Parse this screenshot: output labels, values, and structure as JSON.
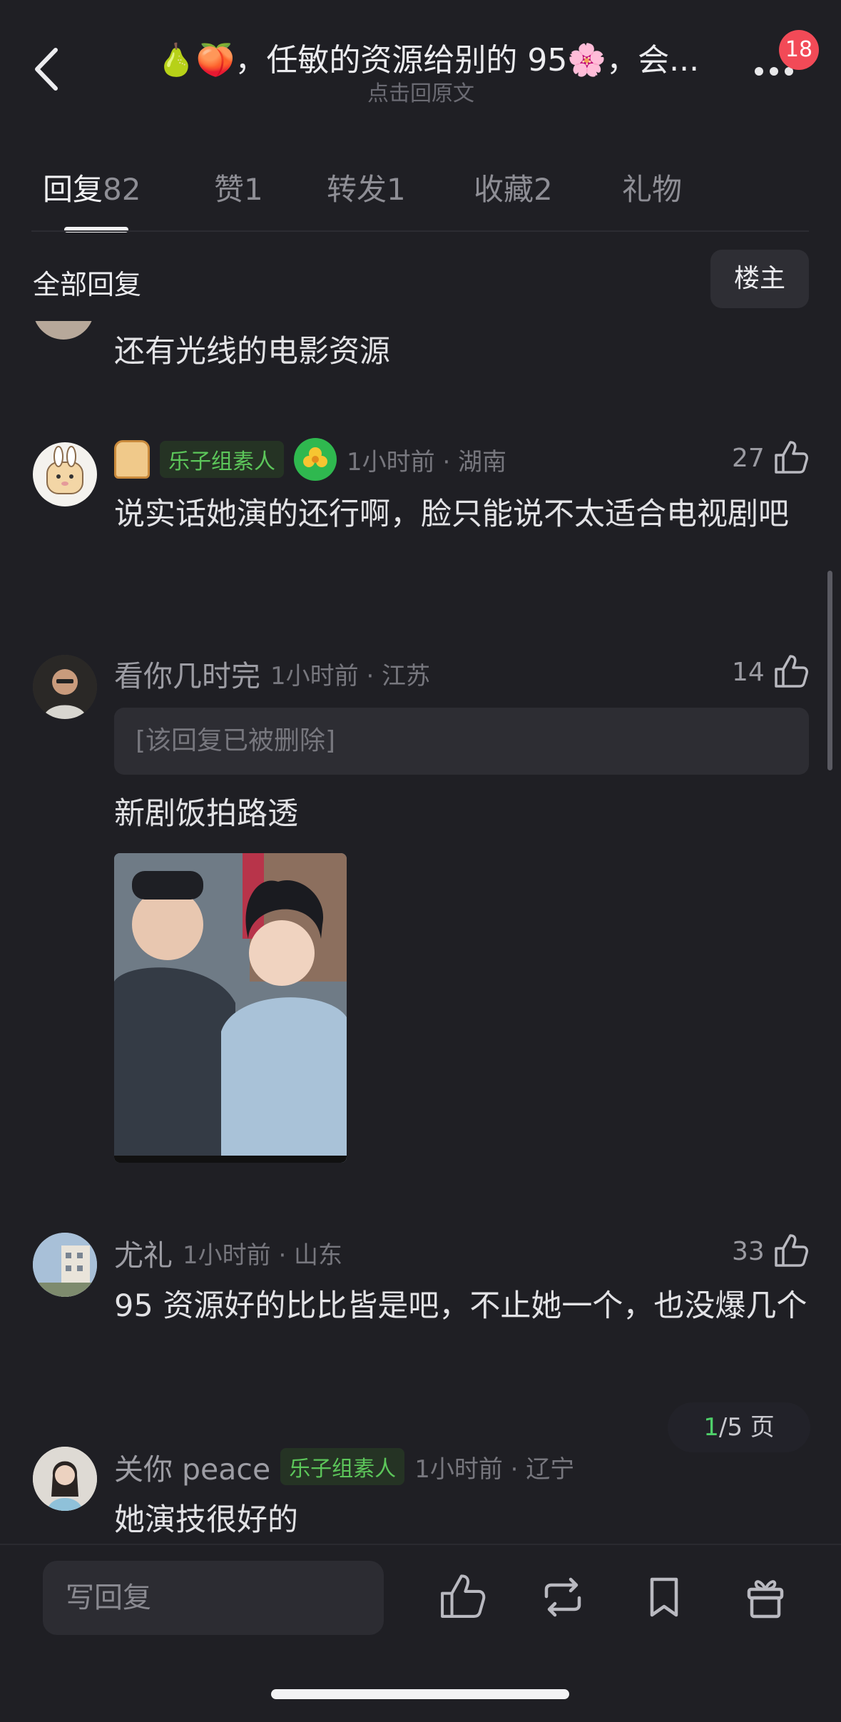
{
  "header": {
    "title": "🍐🍑，任敏的资源给别的 95🌸，会...",
    "subtitle": "点击回原文",
    "badge_count": "18"
  },
  "tabs": [
    {
      "label": "回复",
      "count": "82"
    },
    {
      "label": "赞",
      "count": "1"
    },
    {
      "label": "转发",
      "count": "1"
    },
    {
      "label": "收藏",
      "count": "2"
    },
    {
      "label": "礼物",
      "count": ""
    }
  ],
  "section": {
    "title": "全部回复",
    "owner_button": "楼主"
  },
  "comments": [
    {
      "text": "还有光线的电影资源"
    },
    {
      "username": "",
      "badge": "乐子组素人",
      "time_location": "1小时前 · 湖南",
      "likes": "27",
      "text": "说实话她演的还行啊，脸只能说不太适合电视剧吧"
    },
    {
      "username": "看你几时完",
      "time_location": "1小时前 · 江苏",
      "likes": "14",
      "quoted": "[该回复已被删除]",
      "text": "新剧饭拍路透"
    },
    {
      "username": "尤礼",
      "time_location": "1小时前 · 山东",
      "likes": "33",
      "text": "95 资源好的比比皆是吧，不止她一个，也没爆几个"
    },
    {
      "username": "关你 peace",
      "badge": "乐子组素人",
      "time_location": "1小时前 · 辽宁",
      "text": "她演技很好的"
    }
  ],
  "pager": {
    "current": "1",
    "total": "/5 页"
  },
  "bottombar": {
    "reply_placeholder": "写回复",
    "icons": [
      "like-icon",
      "repost-icon",
      "bookmark-icon",
      "gift-icon"
    ]
  },
  "colors": {
    "background": "#1f1f24",
    "accent_green": "#5cc65a",
    "badge_red": "#f24a57"
  }
}
